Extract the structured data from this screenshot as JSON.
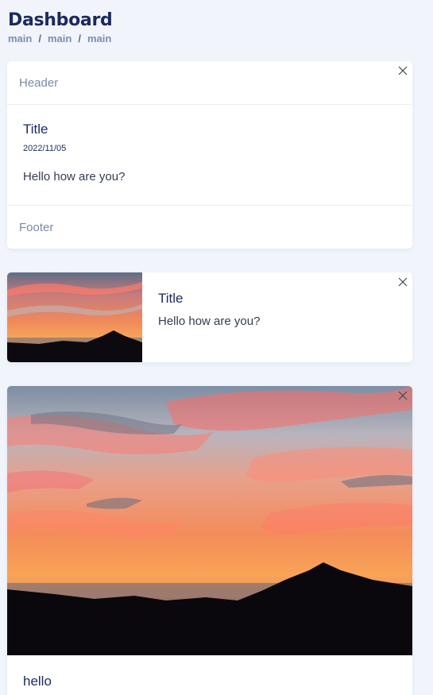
{
  "page": {
    "title": "Dashboard",
    "breadcrumb": [
      "main",
      "main",
      "main"
    ],
    "breadcrumb_separator": "/"
  },
  "cards": [
    {
      "header": "Header",
      "title": "Title",
      "date": "2022/11/05",
      "text": "Hello how are you?",
      "footer": "Footer"
    },
    {
      "title": "Title",
      "text": "Hello how are you?",
      "image": "sunset-mountain-thumbnail"
    },
    {
      "caption": "hello",
      "image": "sunset-mountain-hero"
    }
  ],
  "colors": {
    "background": "#f1f4fb",
    "title": "#1a2b5f",
    "muted": "#7a8aa8"
  },
  "icons": {
    "close": "close-icon"
  }
}
